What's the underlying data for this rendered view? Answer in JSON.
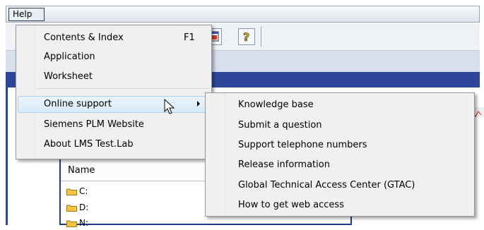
{
  "menubar": {
    "help_label": "Help"
  },
  "help_menu": {
    "items": [
      {
        "label": "Contents & Index",
        "shortcut": "F1"
      },
      {
        "label": "Application"
      },
      {
        "label": "Worksheet"
      },
      {
        "label": "Online support",
        "has_submenu": true,
        "highlighted": true
      },
      {
        "label": "Siemens PLM Website"
      },
      {
        "label": "About LMS Test.Lab"
      }
    ]
  },
  "online_support_submenu": {
    "items": [
      {
        "label": "Knowledge base"
      },
      {
        "label": "Submit a question"
      },
      {
        "label": "Support telephone numbers"
      },
      {
        "label": "Release information"
      },
      {
        "label": "Global Technical Access Center (GTAC)"
      },
      {
        "label": "How to get web access"
      }
    ]
  },
  "browser": {
    "column_header": "Name",
    "drives": [
      "C:",
      "D:",
      "N:"
    ]
  },
  "icons": {
    "toolbar": [
      "window-icon",
      "help-pointer-icon"
    ],
    "submenu_indicator": "chevron-right-icon",
    "cursor": "mouse-pointer-icon",
    "drive": "folder-icon"
  },
  "colors": {
    "accent_navy": "#2e469a",
    "menu_bg": "#f0f0f0",
    "highlight": "#d8ebf9",
    "folder": "#f5c542"
  }
}
